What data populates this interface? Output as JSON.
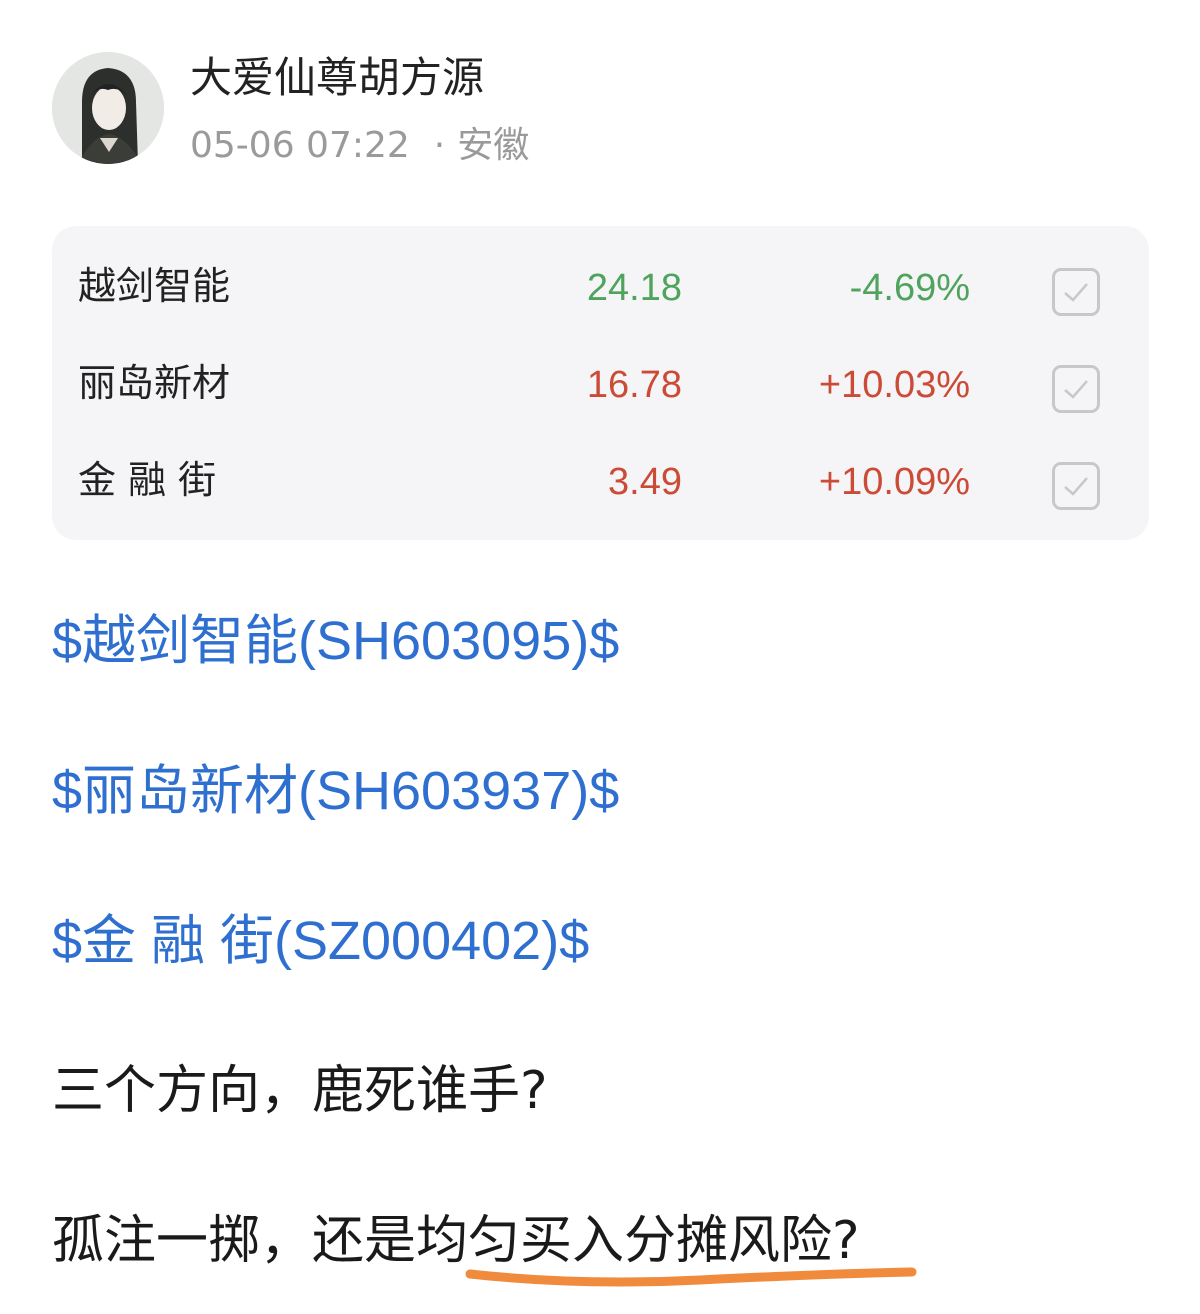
{
  "post": {
    "author": "大爱仙尊胡方源",
    "time": "05-06 07:22",
    "separator": "·",
    "location": "安徽"
  },
  "stocks": [
    {
      "name": "越剑智能",
      "price": "24.18",
      "change": "-4.69%",
      "trend": "down"
    },
    {
      "name": "丽岛新材",
      "price": "16.78",
      "change": "+10.03%",
      "trend": "up"
    },
    {
      "name": "金 融 街",
      "price": "3.49",
      "change": "+10.09%",
      "trend": "up"
    }
  ],
  "links": [
    "$越剑智能(SH603095)$",
    "$丽岛新材(SH603937)$",
    "$金 融 街(SZ000402)$"
  ],
  "body_text": [
    "三个方向，鹿死谁手?",
    "孤注一掷，还是均匀买入分摊风险?"
  ],
  "colors": {
    "up": "#cc4b37",
    "down": "#4fa35c",
    "link": "#2e6fd0",
    "highlight_underline": "#f08a3c"
  },
  "icons": {
    "avatar": "user-avatar",
    "checkbox": "checkmark-icon"
  }
}
